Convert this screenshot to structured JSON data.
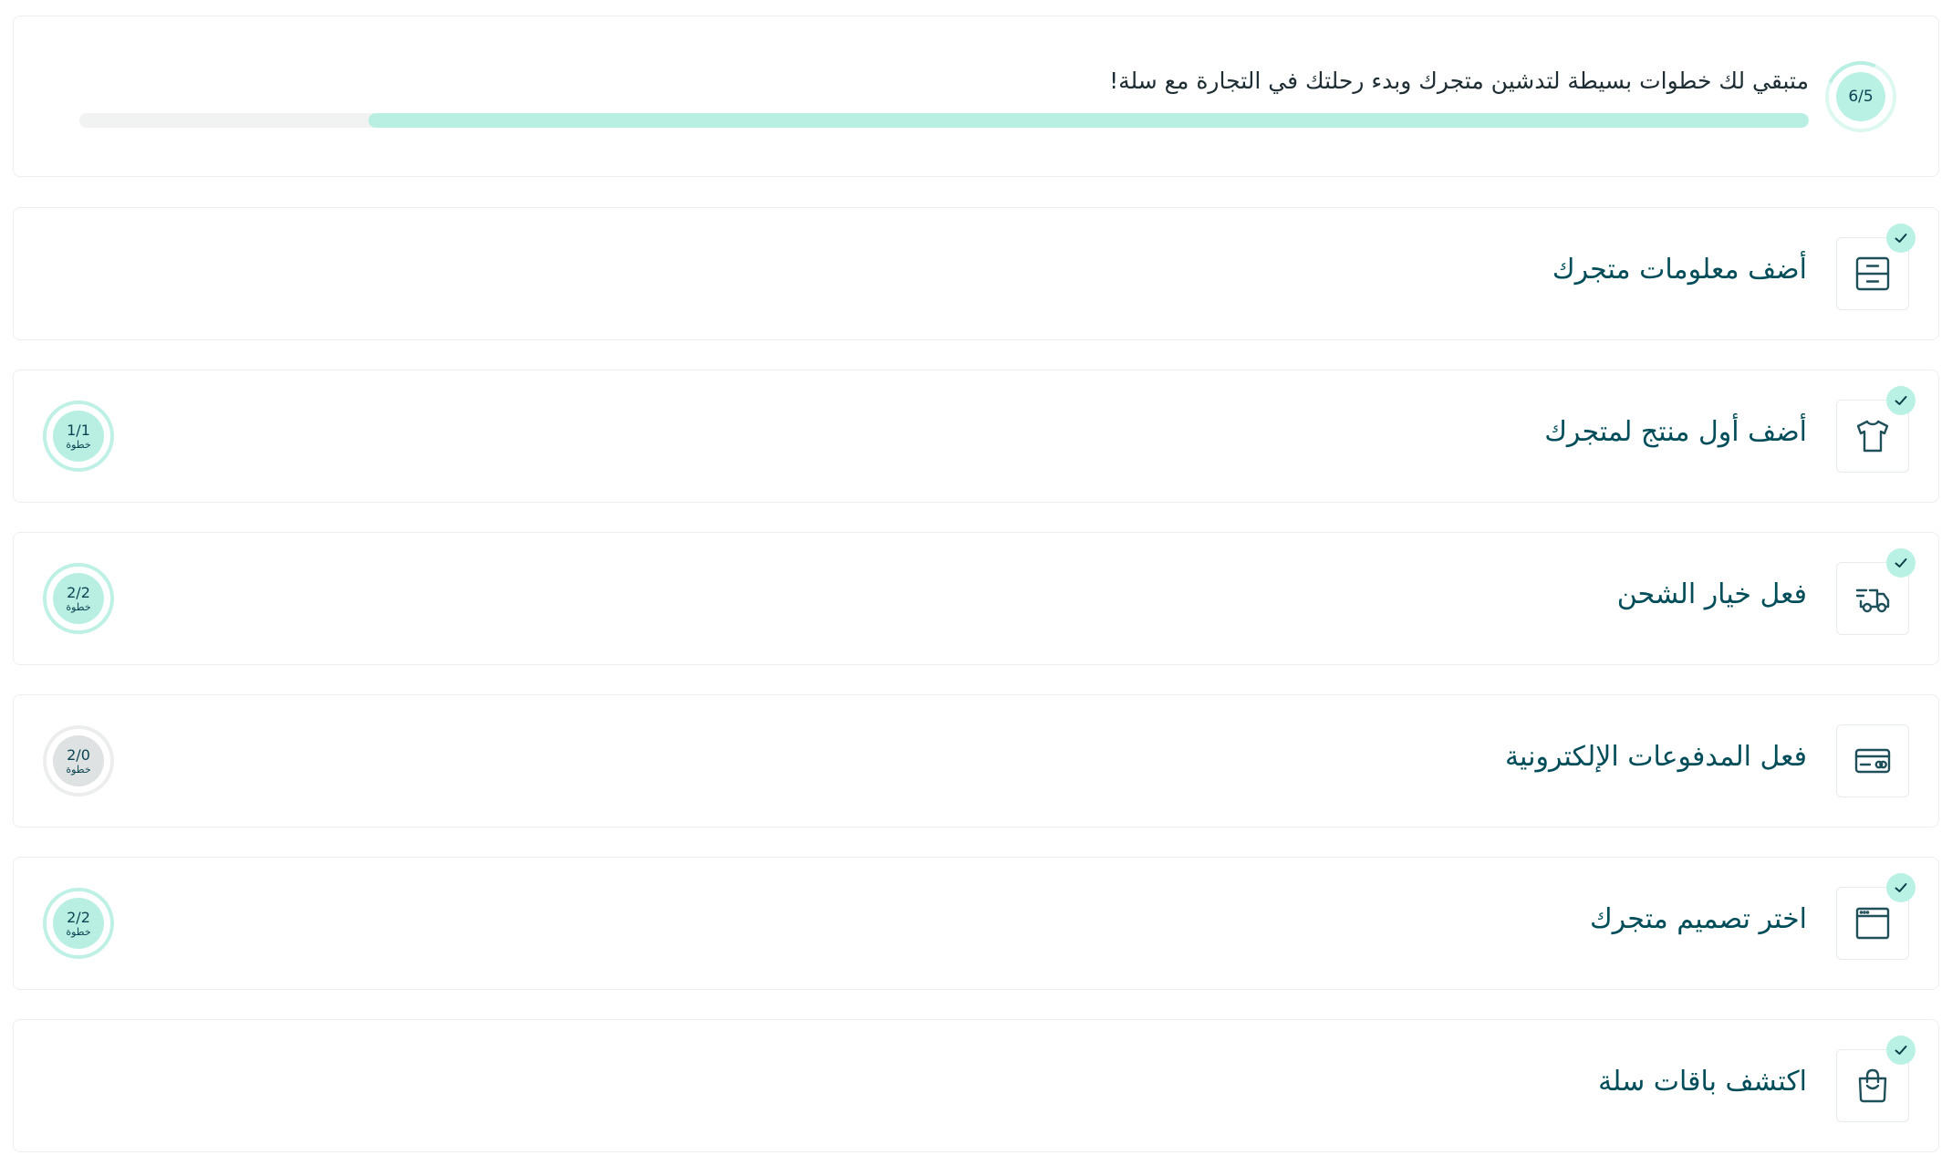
{
  "progress": {
    "counter": "6/5",
    "message": "متبقي لك خطوات بسيطة لتدشين متجرك وبدء رحلتك في التجارة مع سلة!",
    "fraction": 0.833
  },
  "colors": {
    "accent": "#baf1e5",
    "primary_text": "#004d5a",
    "border": "#eceff0"
  },
  "steps": [
    {
      "title": "أضف معلومات متجرك",
      "icon": "store-info-icon",
      "completed": true,
      "count": "",
      "count_label": ""
    },
    {
      "title": "أضف أول منتج لمتجرك",
      "icon": "tshirt-icon",
      "completed": true,
      "count": "1/1",
      "count_label": "خطوة"
    },
    {
      "title": "فعل خيار الشحن",
      "icon": "shipping-truck-icon",
      "completed": true,
      "count": "2/2",
      "count_label": "خطوة"
    },
    {
      "title": "فعل المدفوعات الإلكترونية",
      "icon": "payment-card-icon",
      "completed": false,
      "count": "2/0",
      "count_label": "خطوة"
    },
    {
      "title": "اختر تصميم متجرك",
      "icon": "browser-window-icon",
      "completed": true,
      "count": "2/2",
      "count_label": "خطوة"
    },
    {
      "title": "اكتشف باقات سلة",
      "icon": "shopping-bag-icon",
      "completed": true,
      "count": "",
      "count_label": ""
    }
  ]
}
